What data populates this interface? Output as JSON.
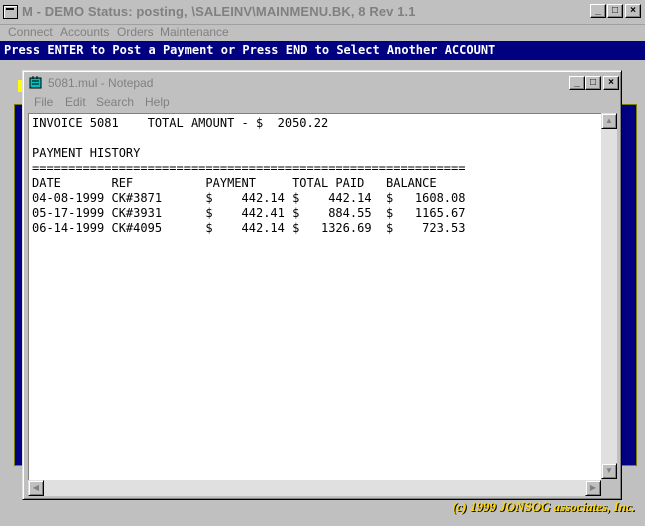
{
  "outer": {
    "title": "M - DEMO Status: posting, \\SALEINV\\MAINMENU.BK, 8 Rev 1.1",
    "menu": [
      "Connect",
      "Accounts",
      "Orders",
      "Maintenance"
    ],
    "status_message": "Press ENTER to Post a Payment or Press END to Select Another ACCOUNT",
    "copyright": "(c) 1999 JONSOG associates, Inc.",
    "buttons": {
      "minimize": "_",
      "maximize": "□",
      "close": "×"
    }
  },
  "notepad": {
    "title": "5081.mul - Notepad",
    "menu": [
      "File",
      "Edit",
      "Search",
      "Help"
    ],
    "buttons": {
      "minimize": "_",
      "maximize": "□",
      "close": "×"
    },
    "lines": [
      "INVOICE 5081    TOTAL AMOUNT - $  2050.22",
      "",
      "PAYMENT HISTORY",
      "============================================================",
      "DATE       REF          PAYMENT     TOTAL PAID   BALANCE",
      "04-08-1999 CK#3871      $    442.14 $    442.14  $   1608.08",
      "05-17-1999 CK#3931      $    442.41 $    884.55  $   1165.67",
      "06-14-1999 CK#4095      $    442.14 $   1326.69  $    723.53"
    ],
    "scroll_arrows": {
      "up": "▲",
      "down": "▼",
      "left": "◀",
      "right": "▶"
    }
  }
}
